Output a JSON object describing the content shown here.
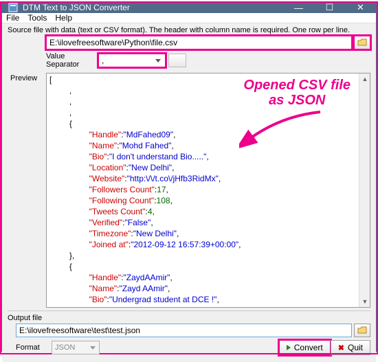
{
  "window": {
    "title": "DTM Text to JSON Converter"
  },
  "menu": {
    "file": "File",
    "tools": "Tools",
    "help": "Help"
  },
  "source": {
    "hint": "Source file with data (text or CSV format). The header with column name is required. One row per line.",
    "path": "E:\\ilovefreesoftware\\Python\\file.csv",
    "sep_label": "Value Separator",
    "sep_value": ","
  },
  "preview": {
    "label": "Preview",
    "records": [
      {
        "Handle": "MdFahed09",
        "Name": "Mohd Fahed",
        "Bio": "I don't understand Bio.....",
        "Location": "New Delhi",
        "Website": "http:\\/\\/t.co\\/jHfb3RidMx",
        "Followers Count": 17,
        "Following Count": 108,
        "Tweets Count": 4,
        "Verified": "False",
        "Timezone": "New Delhi",
        "Joined at": "2012-09-12 16:57:39+00:00"
      },
      {
        "Handle": "ZaydAAmir",
        "Name": "Zayd AAmir",
        "Bio": "Undergrad student at DCE !"
      }
    ]
  },
  "annotation": {
    "line1": "Opened CSV file",
    "line2": "as JSON"
  },
  "output": {
    "label": "Output file",
    "path": "E:\\ilovefreesoftware\\test\\test.json",
    "format_label": "Format",
    "format_value": "JSON"
  },
  "buttons": {
    "convert": "Convert",
    "quit": "Quit"
  }
}
